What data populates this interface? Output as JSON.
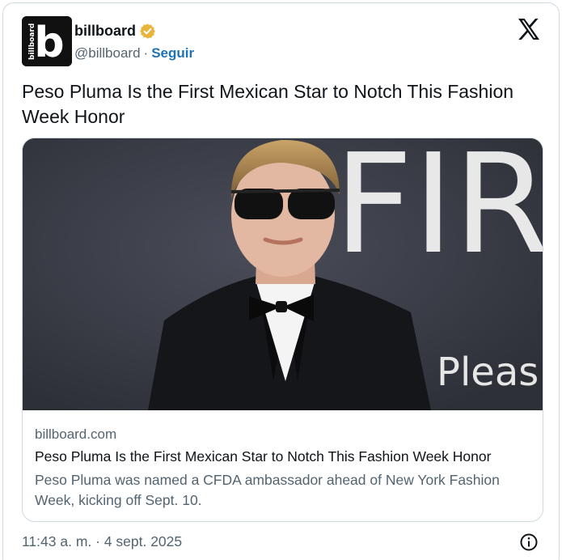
{
  "author": {
    "name": "billboard",
    "handle": "@billboard",
    "separator": "·",
    "follow_label": "Seguir",
    "avatar_letter": "b",
    "avatar_word": "billboard"
  },
  "tweet": {
    "text": "Peso Pluma Is the First Mexican Star to Notch This Fashion Week Honor"
  },
  "card": {
    "backdrop_text_top": "FIR",
    "backdrop_text_bottom": "Pleas",
    "domain": "billboard.com",
    "title": "Peso Pluma Is the First Mexican Star to Notch This Fashion Week Honor",
    "description": "Peso Pluma was named a CFDA ambassador ahead of New York Fashion Week, kicking off Sept. 10."
  },
  "footer": {
    "timestamp": "11:43 a. m. · 4 sept. 2025"
  },
  "icons": {
    "verified": "verified-badge-icon",
    "x_logo": "x-logo-icon",
    "info": "info-icon"
  },
  "colors": {
    "verified_gold": "#e8b53a",
    "follow_blue": "#1d72b8",
    "muted": "#536471"
  }
}
